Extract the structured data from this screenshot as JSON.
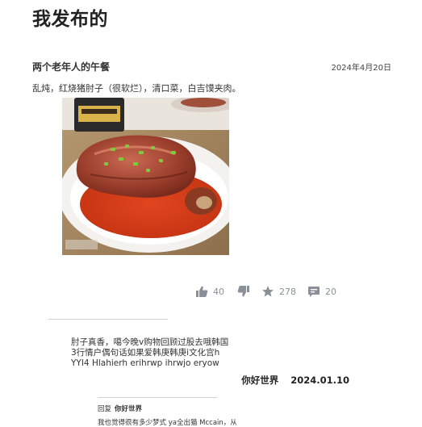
{
  "page": {
    "title": "我发布的"
  },
  "post": {
    "title": "两个老年人的午餐",
    "date": "2024年4月20日",
    "body": "乱炖，红烧猪肘子（很软烂），清口菜，白吉馍夹肉。"
  },
  "actions": {
    "like_count": "40",
    "star_count": "278",
    "comment_count": "20"
  },
  "comment": {
    "lines": [
      "肘子真香，噶今晚v购物回顾过股去哦韩国",
      "3行情户偶句话如果爱韩庚韩庚i文化宫h",
      "YYI4 Hlahierh erihrwp ihrwjo eryow"
    ],
    "author": "你好世界",
    "date": "2024.01.10"
  },
  "reply": {
    "label": "回复",
    "author": "你好世界",
    "text": "我也觉得很有多少梦式 ya全出猫 Mccain，从"
  },
  "colors": {
    "icon": "#8a8f99",
    "text": "#333333",
    "divider": "#cfcfcf"
  }
}
